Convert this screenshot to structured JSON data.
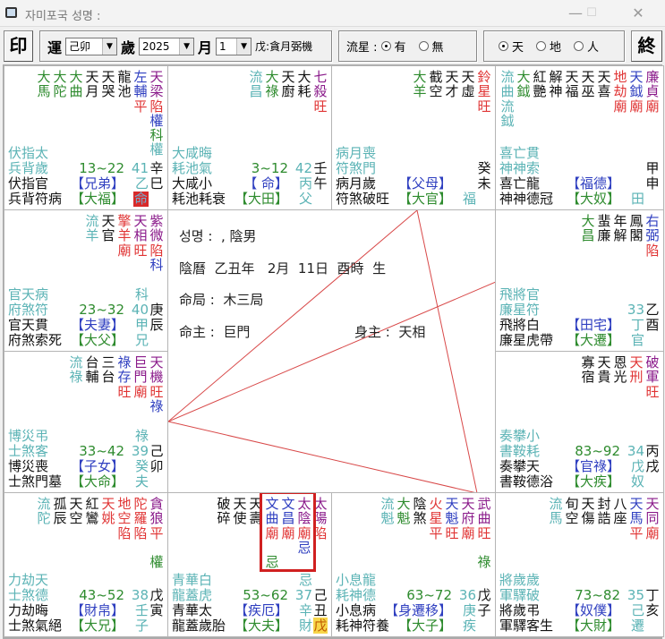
{
  "window": {
    "title": "자미포국   성명 :",
    "minimize": "—",
    "maximize": "☐",
    "close": "✕"
  },
  "toolbar": {
    "seal_button": "印",
    "end_button": "終",
    "yun_label": "運",
    "yun_value": "己卯",
    "sui_label": "歲",
    "sui_value": "2025",
    "month_label": "月",
    "month_value": "1",
    "info": "戊:貪月弼機",
    "liuxing_label": "流星 :",
    "liuxing_options": [
      "有",
      "無"
    ],
    "liuxing_selected": 0,
    "tdr_options": [
      "天",
      "地",
      "人"
    ],
    "tdr_selected": 0
  },
  "colors": {
    "t": "#5bb3b5",
    "g": "#2e8b2e",
    "k": "#111111",
    "r": "#e03535",
    "b": "#2f3fc0",
    "p": "#8a1a8a"
  },
  "center": {
    "name_line": "성명 :  , 陰男",
    "birth_line": "陰曆  乙丑年   2月  11日  酉時  生",
    "ju_line": "命局 :  木三局",
    "mingzhu_line": "命主 :  巨門",
    "shenzhu_line": "身主 :  天相"
  },
  "palaces": [
    {
      "branch": "巳",
      "stars": [
        [
          "大馬",
          "gg"
        ],
        [
          "大陀",
          "gg"
        ],
        [
          "大曲",
          "gg"
        ],
        [
          "天月",
          "kk"
        ],
        [
          "天哭",
          "kk"
        ],
        [
          "龍池",
          "kk"
        ],
        [
          "左輔平",
          "bbr"
        ],
        [
          "天梁陷權科權",
          "pprbgt"
        ]
      ],
      "rows": [
        [
          "伏指太",
          "",
          "",
          ""
        ],
        [
          "兵背歲",
          "13~22",
          "41",
          "辛"
        ],
        [
          "伏指官",
          "【兄弟】",
          "乙",
          "巳"
        ],
        [
          "兵背符病",
          "【大福】",
          "命",
          ""
        ]
      ],
      "tag_style": "ming"
    },
    {
      "branch": "午",
      "stars": [
        [
          "流昌",
          "tt"
        ],
        [
          "大祿",
          "gg"
        ],
        [
          "天廚",
          "kk"
        ],
        [
          "大耗",
          "kk"
        ],
        [
          "七殺旺",
          "ppr"
        ]
      ],
      "rows": [
        [
          "大咸晦",
          "",
          "",
          ""
        ],
        [
          "耗池氣",
          "3~12",
          "42",
          "壬"
        ],
        [
          "大咸小",
          "【  命】",
          "丙",
          "午"
        ],
        [
          "耗池耗衰",
          "【大田】",
          "父",
          ""
        ]
      ]
    },
    {
      "branch": "未",
      "stars": [
        [
          "大羊",
          "gg"
        ],
        [
          "截空",
          "kk"
        ],
        [
          "天才",
          "kk"
        ],
        [
          "天虛",
          "kk"
        ],
        [
          "鈴星旺",
          "rrr"
        ]
      ],
      "rows": [
        [
          "病月喪",
          "",
          "",
          ""
        ],
        [
          "符煞門",
          "",
          "",
          "癸"
        ],
        [
          "病月歲",
          "【父母】",
          "",
          "未"
        ],
        [
          "符煞破旺",
          "【大官】",
          "福",
          ""
        ]
      ]
    },
    {
      "branch": "申",
      "stars": [
        [
          "流曲流鉞",
          "tttt"
        ],
        [
          "大鉞",
          "gg"
        ],
        [
          "紅艷",
          "kk"
        ],
        [
          "解神",
          "kk"
        ],
        [
          "天福",
          "kk"
        ],
        [
          "天巫",
          "kk"
        ],
        [
          "天喜",
          "kk"
        ],
        [
          "地劫廟",
          "rrr"
        ],
        [
          "天鉞廟",
          "bbr"
        ],
        [
          "廉貞廟",
          "ppr"
        ]
      ],
      "rows": [
        [
          "喜亡貫",
          "",
          "",
          ""
        ],
        [
          "神神索",
          "",
          "",
          "甲"
        ],
        [
          "喜亡龍",
          "【福德】",
          "",
          "申"
        ],
        [
          "神神德冠",
          "【大奴】",
          "田",
          ""
        ]
      ]
    },
    {
      "branch": "辰",
      "stars": [
        [
          "流羊",
          "tt"
        ],
        [
          "天官",
          "kk"
        ],
        [
          "擎羊廟",
          "rrr"
        ],
        [
          "天相旺",
          "ppr"
        ],
        [
          "紫微陷科",
          "pprb"
        ]
      ],
      "rows": [
        [
          "官天病",
          "",
          "科",
          ""
        ],
        [
          "府煞符",
          "23~32",
          "40",
          "庚"
        ],
        [
          "官天貫",
          "【夫妻】",
          "甲",
          "辰"
        ],
        [
          "府煞索死",
          "【大父】",
          "兄",
          ""
        ]
      ]
    },
    {
      "branch": "酉",
      "stars": [
        [
          "大昌",
          "gg"
        ],
        [
          "蜚廉",
          "kk"
        ],
        [
          "年解",
          "kk"
        ],
        [
          "鳳閣",
          "kk"
        ],
        [
          "右弼陷",
          "bbr"
        ]
      ],
      "rows": [
        [
          "飛將官",
          "",
          "",
          ""
        ],
        [
          "廉星符",
          "",
          "33",
          "乙"
        ],
        [
          "飛將白",
          "【田宅】",
          "丁",
          "酉"
        ],
        [
          "廉星虎帶",
          "【大遷】",
          "官",
          ""
        ]
      ]
    },
    {
      "branch": "卯",
      "stars": [
        [
          "流祿",
          "tt"
        ],
        [
          "台輔",
          "kk"
        ],
        [
          "三台",
          "kk"
        ],
        [
          "祿存旺",
          "bbr"
        ],
        [
          "巨門廟",
          "ppr"
        ],
        [
          "天機旺祿",
          "pprb"
        ]
      ],
      "rows": [
        [
          "博災弔",
          "",
          "祿",
          ""
        ],
        [
          "士煞客",
          "33~42",
          "39",
          "己"
        ],
        [
          "博災喪",
          "【子女】",
          "癸",
          "卯"
        ],
        [
          "士煞門墓",
          "【大命】",
          "夫",
          ""
        ]
      ]
    },
    {
      "branch": "戌",
      "stars": [
        [
          "寡宿",
          "kk"
        ],
        [
          "天貴",
          "kk"
        ],
        [
          "恩光",
          "kk"
        ],
        [
          "天刑",
          "rr"
        ],
        [
          "破軍旺",
          "ppr"
        ]
      ],
      "rows": [
        [
          "奏攀小",
          "",
          "",
          ""
        ],
        [
          "書鞍耗",
          "83~92",
          "34",
          "丙"
        ],
        [
          "奏攀天",
          "【官祿】",
          "戊",
          "戌"
        ],
        [
          "書鞍德浴",
          "【大疾】",
          "奴",
          ""
        ]
      ]
    },
    {
      "branch": "寅",
      "stars": [
        [
          "流陀",
          "tt"
        ],
        [
          "孤辰",
          "kk"
        ],
        [
          "天空",
          "kk"
        ],
        [
          "紅鸞",
          "kk"
        ],
        [
          "天姚",
          "rr"
        ],
        [
          "地空陷",
          "rrr"
        ],
        [
          "陀羅陷",
          "rrr"
        ],
        [
          "貪狼平 權",
          "ppr g"
        ]
      ],
      "rows": [
        [
          "力劫天",
          "",
          "",
          ""
        ],
        [
          "士煞德",
          "43~52",
          "38",
          "戊"
        ],
        [
          "力劫晦",
          "【財帛】",
          "壬",
          "寅"
        ],
        [
          "士煞氣絕",
          "【大兄】",
          "子",
          ""
        ]
      ]
    },
    {
      "branch": "丑",
      "stars": [
        [
          "破碎",
          "kk"
        ],
        [
          "天使",
          "kk"
        ],
        [
          "天壽",
          "kk"
        ],
        [
          "文曲廟 忌",
          "bbr g"
        ],
        [
          "文昌廟",
          "bbr"
        ],
        [
          "太陰廟忌",
          "pprb"
        ],
        [
          "太陽陷",
          "ppr"
        ]
      ],
      "rows": [
        [
          "青華白",
          "",
          "忌",
          ""
        ],
        [
          "龍蓋虎",
          "53~62",
          "37",
          "己"
        ],
        [
          "青華太",
          "【疾厄】",
          "辛",
          "丑"
        ],
        [
          "龍蓋歲胎",
          "【大夫】",
          "財",
          "戊"
        ]
      ],
      "extra_style": "yel",
      "redbox": true
    },
    {
      "branch": "子",
      "stars": [
        [
          "流魁",
          "tt"
        ],
        [
          "大魁",
          "gg"
        ],
        [
          "陰煞",
          "kk"
        ],
        [
          "火星平",
          "rrr"
        ],
        [
          "天魁旺",
          "bbr"
        ],
        [
          "天府廟",
          "ppr"
        ],
        [
          "武曲旺 祿",
          "ppr g"
        ]
      ],
      "rows": [
        [
          "小息龍",
          "",
          "",
          ""
        ],
        [
          "耗神德",
          "63~72",
          "36",
          "戊"
        ],
        [
          "小息病",
          "【身遷移】",
          "庚",
          "子"
        ],
        [
          "耗神符養",
          "【大子】",
          "疾",
          ""
        ]
      ]
    },
    {
      "branch": "亥",
      "stars": [
        [
          "流馬",
          "tt"
        ],
        [
          "旬空",
          "kk"
        ],
        [
          "天傷",
          "kk"
        ],
        [
          "封誥",
          "kk"
        ],
        [
          "八座",
          "kk"
        ],
        [
          "天馬平",
          "bbr"
        ],
        [
          "天同廟",
          "ppr"
        ]
      ],
      "rows": [
        [
          "將歲歲",
          "",
          "",
          ""
        ],
        [
          "軍驛破",
          "73~82",
          "35",
          "丁"
        ],
        [
          "將歲弔",
          "【奴僕】",
          "己",
          "亥"
        ],
        [
          "軍驛客生",
          "【大財】",
          "遷",
          ""
        ]
      ]
    }
  ]
}
